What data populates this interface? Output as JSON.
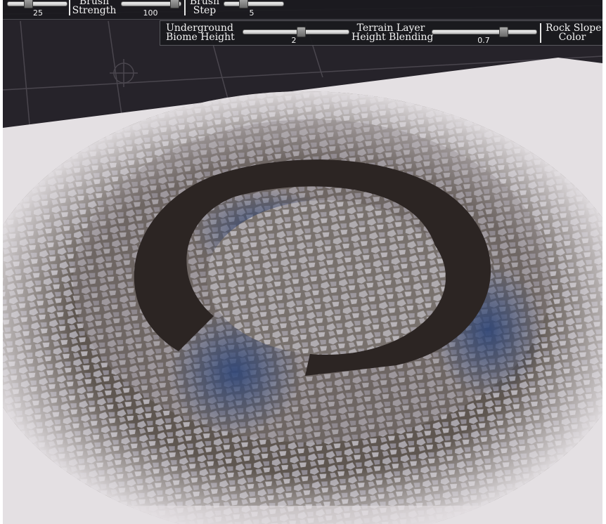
{
  "toolbar_top": {
    "brush_size": {
      "value": "25"
    },
    "brush_strength": {
      "label_line1": "Brush",
      "label_line2": "Strength",
      "value": "100"
    },
    "brush_step": {
      "label_line1": "Brush",
      "label_line2": "Step",
      "value": "5"
    }
  },
  "toolbar_second": {
    "underground_biome_height": {
      "label_line1": "Underground",
      "label_line2": "Biome Height",
      "value": "2"
    },
    "terrain_layer_height_blending": {
      "label_line1": "Terrain Layer",
      "label_line2": "Height Blending",
      "value": "0.7"
    },
    "rock_slope_color": {
      "label_line1": "Rock Slope",
      "label_line2": "Color"
    }
  },
  "colors": {
    "grid_background": "#26232a",
    "terrain_plane": "#e4e0e3",
    "dark_ring": "#2c2523",
    "blue_rock": "#33456e"
  }
}
